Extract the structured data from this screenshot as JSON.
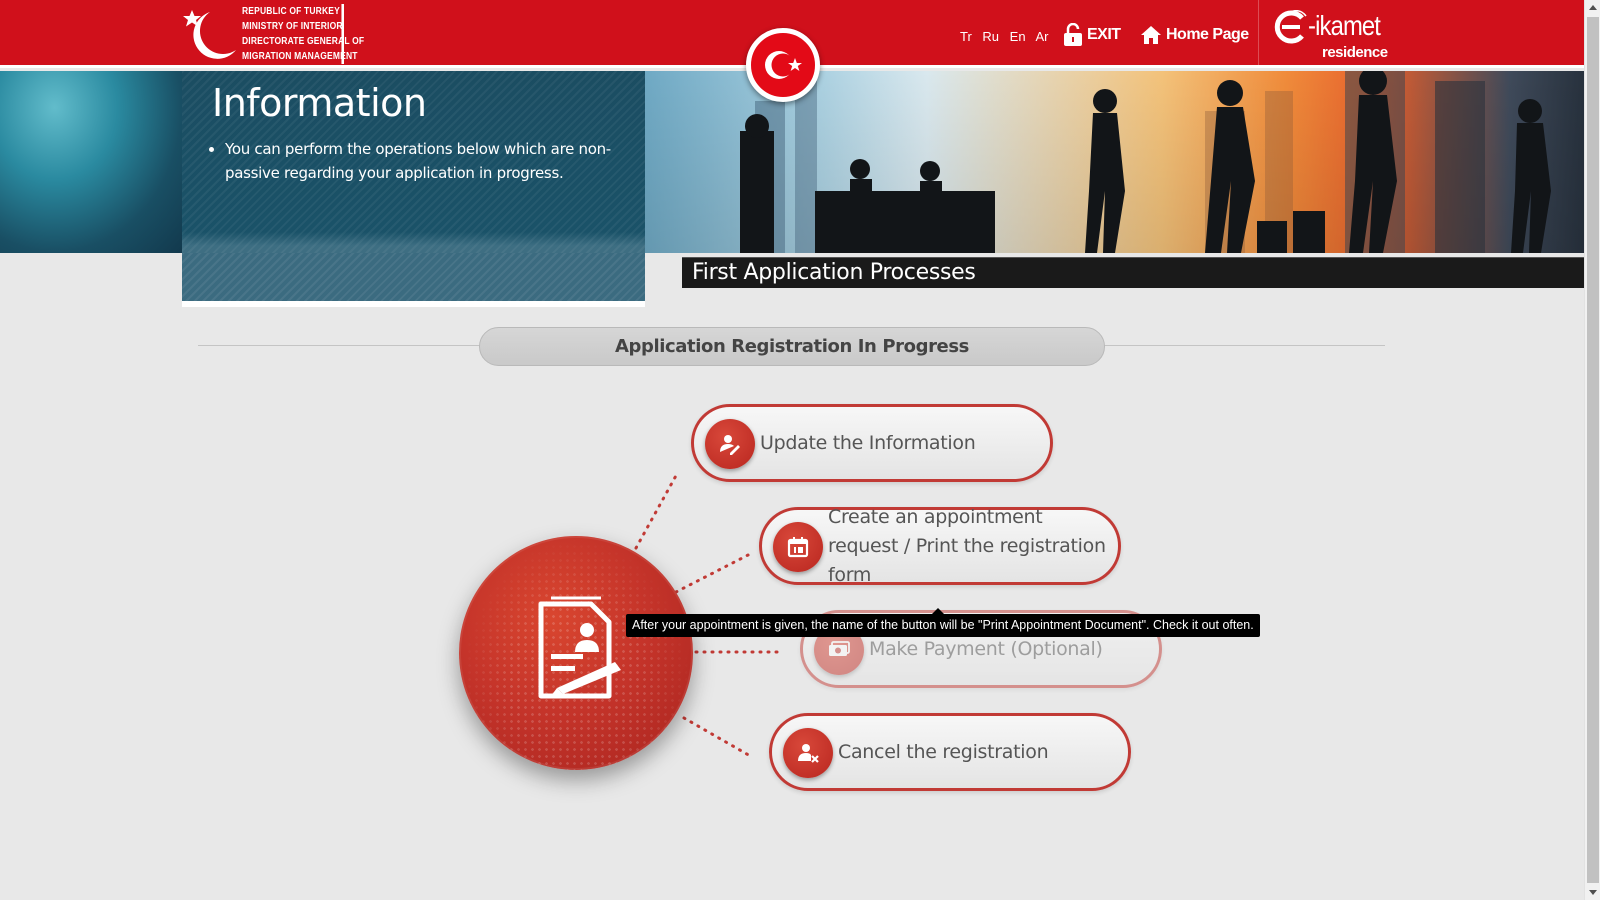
{
  "header": {
    "gov_logo_lines": [
      "REPUBLIC OF TURKEY",
      "MINISTRY OF INTERIOR",
      "DIRECTORATE GENERAL OF",
      "MIGRATION MANAGEMENT"
    ],
    "languages": [
      "Tr",
      "Ru",
      "En",
      "Ar"
    ],
    "exit_label": "EXIT",
    "home_label": "Home Page",
    "brand": {
      "word": "-ikamet",
      "sub": "residence"
    }
  },
  "info": {
    "title": "Information",
    "bullets": [
      "You can perform the operations below which are non-passive regarding your application in progress."
    ]
  },
  "processes_title": "First Application Processes",
  "section_title": "Application Registration In Progress",
  "actions": [
    {
      "label": "Update the Information",
      "icon": "user-edit-icon"
    },
    {
      "label": "Create an appointment request / Print the registration form",
      "icon": "calendar-icon"
    },
    {
      "label": "Make Payment (Optional)",
      "icon": "money-icon",
      "state": "disabled"
    },
    {
      "label": "Cancel the registration",
      "icon": "user-cancel-icon"
    }
  ],
  "tooltip": "After your appointment is given, the name of the button will be \"Print Appointment Document\". Check it out often.",
  "colors": {
    "header_red": "#d0101b",
    "accent_red": "#c13a35",
    "info_panel": "#1b4d62",
    "page_bg": "#e8e8e8"
  }
}
